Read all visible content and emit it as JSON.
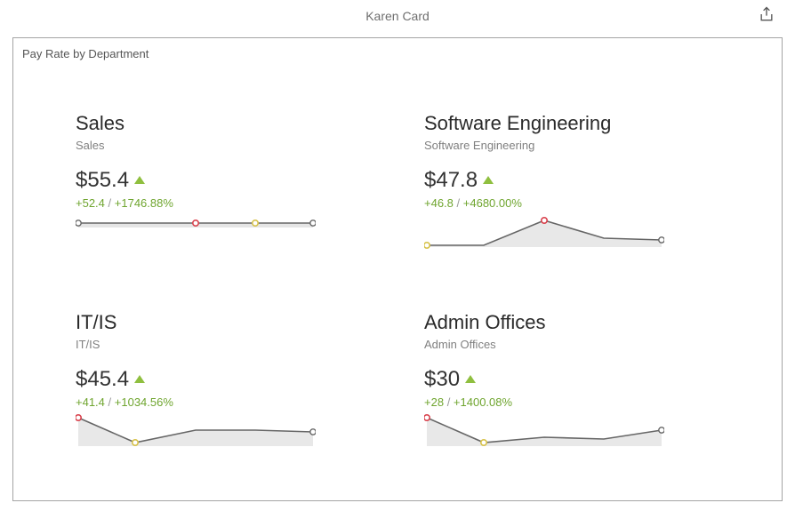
{
  "header": {
    "title": "Karen Card"
  },
  "card": {
    "title": "Pay Rate by Department"
  },
  "kpis": [
    {
      "title": "Sales",
      "subtitle": "Sales",
      "value": "$55.4",
      "delta_abs": "+52.4",
      "delta_pct": "+1746.88%"
    },
    {
      "title": "Software Engineering",
      "subtitle": "Software Engineering",
      "value": "$47.8",
      "delta_abs": "+46.8",
      "delta_pct": "+4680.00%"
    },
    {
      "title": "IT/IS",
      "subtitle": "IT/IS",
      "value": "$45.4",
      "delta_abs": "+41.4",
      "delta_pct": "+1034.56%"
    },
    {
      "title": "Admin Offices",
      "subtitle": "Admin Offices",
      "value": "$30",
      "delta_abs": "+28",
      "delta_pct": "+1400.08%"
    }
  ],
  "chart_data": [
    {
      "type": "line",
      "title": "Sales sparkline",
      "x": [
        0,
        1,
        2,
        3,
        4
      ],
      "y": [
        3,
        3,
        3,
        3,
        3
      ],
      "markers": {
        "red_index": 2,
        "yellow_index": 3
      },
      "ylim": [
        0,
        60
      ]
    },
    {
      "type": "line",
      "title": "Software Engineering sparkline",
      "x": [
        0,
        1,
        2,
        3,
        4
      ],
      "y": [
        1,
        1,
        22,
        6,
        5
      ],
      "markers": {
        "red_index": 2,
        "yellow_index": 0
      },
      "ylim": [
        0,
        50
      ]
    },
    {
      "type": "line",
      "title": "IT/IS sparkline",
      "x": [
        0,
        1,
        2,
        3,
        4
      ],
      "y": [
        48,
        4,
        12,
        12,
        10
      ],
      "markers": {
        "red_index": 0,
        "yellow_index": 1
      },
      "ylim": [
        0,
        50
      ]
    },
    {
      "type": "line",
      "title": "Admin Offices sparkline",
      "x": [
        0,
        1,
        2,
        3,
        4
      ],
      "y": [
        28,
        4,
        6,
        5,
        10
      ],
      "markers": {
        "red_index": 0,
        "yellow_index": 1
      },
      "ylim": [
        0,
        30
      ]
    }
  ]
}
